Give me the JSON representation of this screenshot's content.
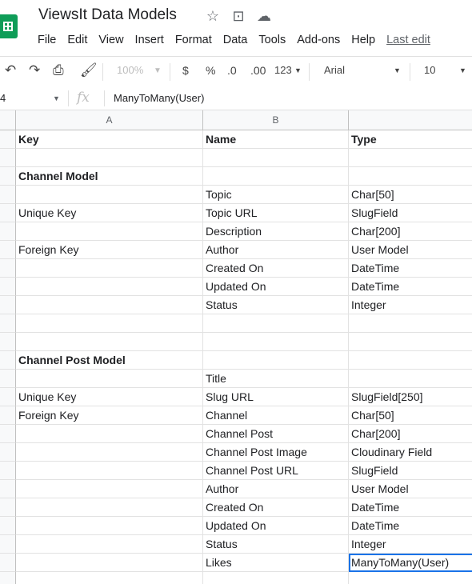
{
  "app": {
    "title": "ViewsIt Data Models",
    "menu": [
      "File",
      "Edit",
      "View",
      "Insert",
      "Format",
      "Data",
      "Tools",
      "Add-ons",
      "Help"
    ],
    "last_edit": "Last edit"
  },
  "toolbar": {
    "zoom": "100%",
    "currency": "$",
    "percent": "%",
    "dec_decrease": ".0",
    "dec_increase": ".00",
    "more_formats": "123",
    "font": "Arial",
    "font_size": "10"
  },
  "formula_bar": {
    "name_box": "4",
    "fx": "fx",
    "content": "ManyToMany(User)"
  },
  "columns": [
    "A",
    "B"
  ],
  "rows": [
    {
      "a": "Key",
      "b": "Name",
      "c": "Type",
      "bold": true
    },
    {
      "a": "",
      "b": "",
      "c": ""
    },
    {
      "a": "Channel Model",
      "b": "",
      "c": "",
      "bold": true
    },
    {
      "a": "",
      "b": "Topic",
      "c": "Char[50]"
    },
    {
      "a": "Unique Key",
      "b": "Topic URL",
      "c": "SlugField"
    },
    {
      "a": "",
      "b": "Description",
      "c": "Char[200]"
    },
    {
      "a": "Foreign Key",
      "b": "Author",
      "c": "User Model"
    },
    {
      "a": "",
      "b": "Created On",
      "c": "DateTime"
    },
    {
      "a": "",
      "b": "Updated On",
      "c": "DateTime"
    },
    {
      "a": "",
      "b": "Status",
      "c": "Integer"
    },
    {
      "a": "",
      "b": "",
      "c": ""
    },
    {
      "a": "",
      "b": "",
      "c": ""
    },
    {
      "a": "Channel Post Model",
      "b": "",
      "c": "",
      "bold": true
    },
    {
      "a": "",
      "b": "Title",
      "c": ""
    },
    {
      "a": "Unique Key",
      "b": "Slug URL",
      "c": "SlugField[250]"
    },
    {
      "a": "Foreign Key",
      "b": "Channel",
      "c": "Char[50]"
    },
    {
      "a": "",
      "b": "Channel Post",
      "c": "Char[200]"
    },
    {
      "a": "",
      "b": "Channel Post Image",
      "c": "Cloudinary Field"
    },
    {
      "a": "",
      "b": "Channel Post URL",
      "c": "SlugField"
    },
    {
      "a": "",
      "b": "Author",
      "c": "User Model"
    },
    {
      "a": "",
      "b": "Created On",
      "c": "DateTime"
    },
    {
      "a": "",
      "b": "Updated On",
      "c": "DateTime"
    },
    {
      "a": "",
      "b": "Status",
      "c": "Integer"
    },
    {
      "a": "",
      "b": "Likes",
      "c": "ManyToMany(User)",
      "selected": true
    },
    {
      "a": "",
      "b": "",
      "c": ""
    }
  ]
}
